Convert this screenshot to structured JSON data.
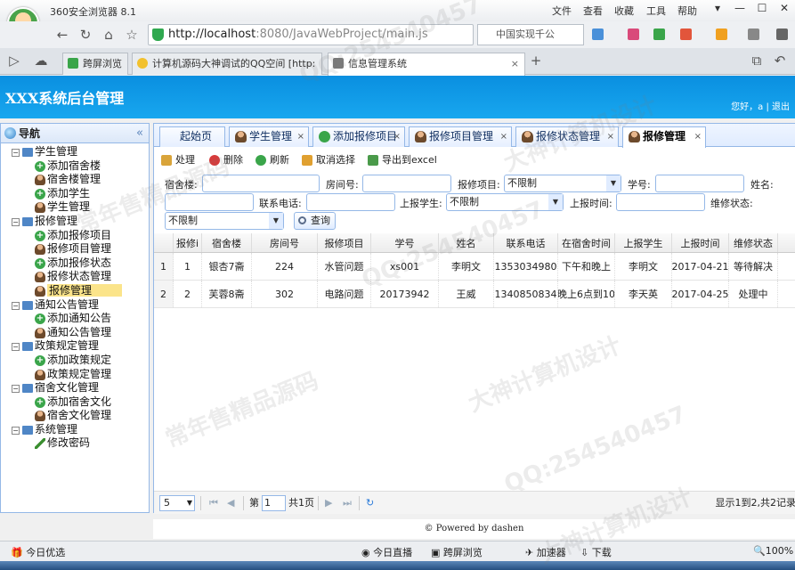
{
  "browser": {
    "app_title": "360安全浏览器 8.1",
    "menu": [
      "文件",
      "查看",
      "收藏",
      "工具",
      "帮助"
    ],
    "url_host": "http://localhost",
    "url_rest": ":8080/JavaWebProject/main.js",
    "search_text": "中国实现千公",
    "tabs": [
      {
        "label": "跨屏浏览",
        "active": false
      },
      {
        "label": "计算机源码大神调试的QQ空间 [http:",
        "active": false
      },
      {
        "label": "信息管理系统",
        "active": true
      }
    ],
    "new_tab": "+"
  },
  "app": {
    "brand": "XXX系统后台管理",
    "user_text": "您好，a | 退出"
  },
  "sidebar": {
    "title": "导航",
    "groups": [
      {
        "label": "学生管理",
        "items": [
          {
            "label": "添加宿舍楼",
            "icon": "add"
          },
          {
            "label": "宿舍楼管理",
            "icon": "mgr"
          },
          {
            "label": "添加学生",
            "icon": "add"
          },
          {
            "label": "学生管理",
            "icon": "mgr"
          }
        ]
      },
      {
        "label": "报修管理",
        "items": [
          {
            "label": "添加报修项目",
            "icon": "add"
          },
          {
            "label": "报修项目管理",
            "icon": "mgr"
          },
          {
            "label": "添加报修状态",
            "icon": "add"
          },
          {
            "label": "报修状态管理",
            "icon": "mgr"
          },
          {
            "label": "报修管理",
            "icon": "mgr",
            "selected": true
          }
        ]
      },
      {
        "label": "通知公告管理",
        "items": [
          {
            "label": "添加通知公告",
            "icon": "add"
          },
          {
            "label": "通知公告管理",
            "icon": "mgr"
          }
        ]
      },
      {
        "label": "政策规定管理",
        "items": [
          {
            "label": "添加政策规定",
            "icon": "add"
          },
          {
            "label": "政策规定管理",
            "icon": "mgr"
          }
        ]
      },
      {
        "label": "宿舍文化管理",
        "items": [
          {
            "label": "添加宿舍文化",
            "icon": "add"
          },
          {
            "label": "宿舍文化管理",
            "icon": "mgr"
          }
        ]
      },
      {
        "label": "系统管理",
        "items": [
          {
            "label": "修改密码",
            "icon": "pen"
          }
        ]
      }
    ]
  },
  "panel_tabs": [
    {
      "label": "起始页",
      "closable": false,
      "icon": "none"
    },
    {
      "label": "学生管理",
      "closable": true,
      "icon": "mgr"
    },
    {
      "label": "添加报修项目",
      "closable": true,
      "icon": "add"
    },
    {
      "label": "报修项目管理",
      "closable": true,
      "icon": "mgr"
    },
    {
      "label": "报修状态管理",
      "closable": true,
      "icon": "mgr"
    },
    {
      "label": "报修管理",
      "closable": true,
      "icon": "mgr",
      "active": true
    }
  ],
  "toolbar": {
    "process": "处理",
    "delete": "删除",
    "refresh": "刷新",
    "cancel_select": "取消选择",
    "export": "导出到excel"
  },
  "search_form": {
    "building_label": "宿舍楼:",
    "room_label": "房间号:",
    "item_label": "报修项目:",
    "item_value": "不限制",
    "student_no_label": "学号:",
    "name_label": "姓名:",
    "phone_label": "联系电话:",
    "reporter_label": "上报学生:",
    "reporter_value": "不限制",
    "report_time_label": "上报时间:",
    "status_label": "维修状态:",
    "status_value": "不限制",
    "query_button": "查询"
  },
  "grid": {
    "columns": [
      "",
      "报修i",
      "宿舍楼",
      "房间号",
      "报修项目",
      "学号",
      "姓名",
      "联系电话",
      "在宿舍时间",
      "上报学生",
      "上报时间",
      "维修状态"
    ],
    "rows": [
      [
        "1",
        "1",
        "银杏7斋",
        "224",
        "水管问题",
        "xs001",
        "李明文",
        "1353034980",
        "下午和晚上",
        "李明文",
        "2017-04-21",
        "等待解决"
      ],
      [
        "2",
        "2",
        "芙蓉8斋",
        "302",
        "电路问题",
        "20173942",
        "王威",
        "1340850834",
        "晚上6点到10",
        "李天英",
        "2017-04-25",
        "处理中"
      ]
    ]
  },
  "pager": {
    "page_size": "5",
    "page_prefix": "第",
    "page_number": "1",
    "page_suffix": "共1页",
    "summary": "显示1到2,共2记录"
  },
  "footer": "© Powered by dashen",
  "statusbar": {
    "left": "今日优选",
    "items": [
      "今日直播",
      "跨屏浏览",
      "加速器",
      "下载"
    ],
    "zoom": "100%"
  },
  "watermarks": [
    "QQ:254540457",
    "大神计算机设计",
    "常年售精品源码",
    "QQ:254540457",
    "大神计算机设计",
    "常年售精品源码",
    "QQ:254540457",
    "大神计算机设计"
  ],
  "colors": {
    "header_blue": "#0a8fe0",
    "panel_border": "#95b8e7",
    "selected_node": "#fbe48a"
  }
}
